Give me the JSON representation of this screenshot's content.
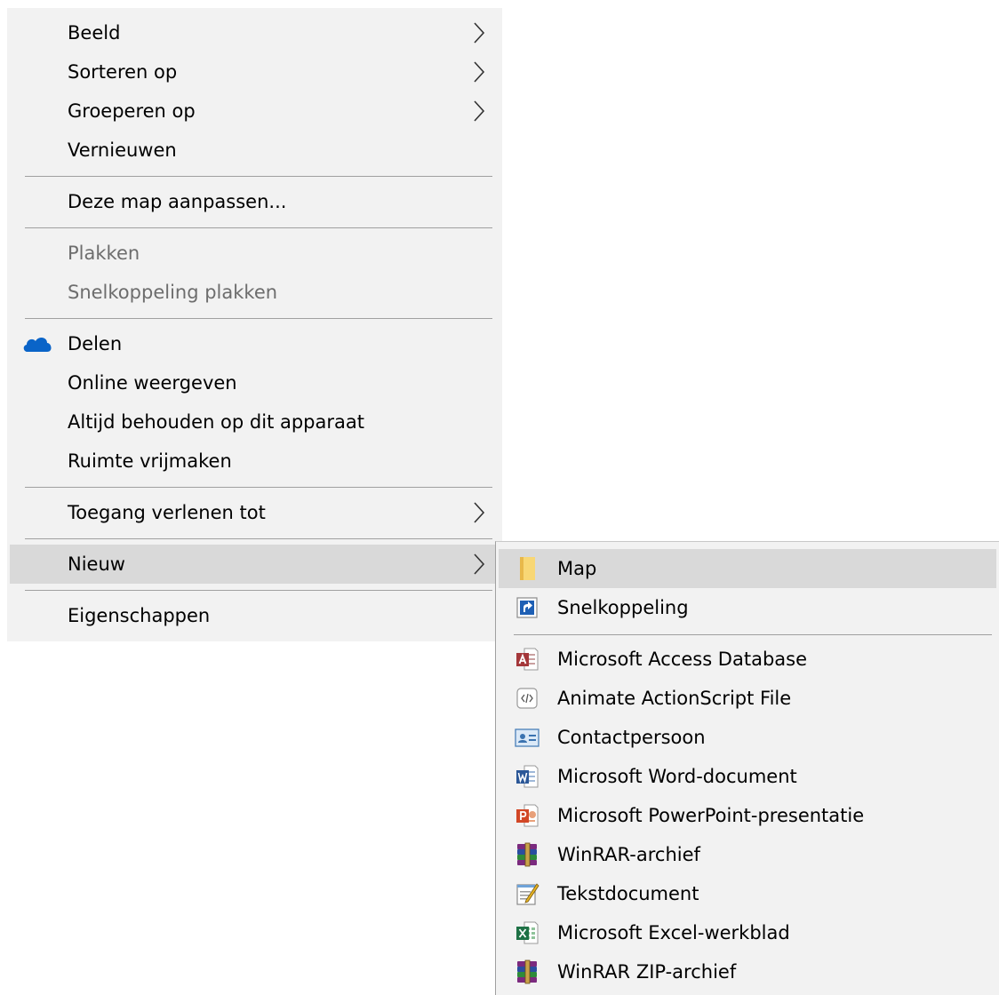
{
  "main_menu": {
    "items": [
      {
        "label": "Beeld",
        "submenu": true
      },
      {
        "label": "Sorteren op",
        "submenu": true
      },
      {
        "label": "Groeperen op",
        "submenu": true
      },
      {
        "label": "Vernieuwen"
      },
      {
        "label": "Deze map aanpassen..."
      },
      {
        "label": "Plakken",
        "disabled": true
      },
      {
        "label": "Snelkoppeling plakken",
        "disabled": true
      },
      {
        "label": "Delen",
        "icon": "onedrive-cloud-icon"
      },
      {
        "label": "Online weergeven"
      },
      {
        "label": "Altijd behouden op dit apparaat"
      },
      {
        "label": "Ruimte vrijmaken"
      },
      {
        "label": "Toegang verlenen tot",
        "submenu": true
      },
      {
        "label": "Nieuw",
        "submenu": true,
        "highlighted": true
      },
      {
        "label": "Eigenschappen"
      }
    ]
  },
  "new_submenu": {
    "items": [
      {
        "label": "Map",
        "icon": "folder-icon",
        "highlighted": true
      },
      {
        "label": "Snelkoppeling",
        "icon": "shortcut-icon"
      },
      {
        "label": "Microsoft Access Database",
        "icon": "access-database-icon"
      },
      {
        "label": "Animate ActionScript File",
        "icon": "actionscript-file-icon"
      },
      {
        "label": "Contactpersoon",
        "icon": "contact-card-icon"
      },
      {
        "label": "Microsoft Word-document",
        "icon": "word-document-icon"
      },
      {
        "label": "Microsoft PowerPoint-presentatie",
        "icon": "powerpoint-presentation-icon"
      },
      {
        "label": "WinRAR-archief",
        "icon": "winrar-archive-icon"
      },
      {
        "label": "Tekstdocument",
        "icon": "text-document-icon"
      },
      {
        "label": "Microsoft Excel-werkblad",
        "icon": "excel-worksheet-icon"
      },
      {
        "label": "WinRAR ZIP-archief",
        "icon": "winrar-zip-archive-icon"
      }
    ]
  },
  "colors": {
    "menu_background": "#f2f2f2",
    "highlight": "#d9d9d9",
    "separator": "#a0a0a0",
    "disabled_text": "#6d6d6d",
    "onedrive_blue": "#0a64c8"
  }
}
